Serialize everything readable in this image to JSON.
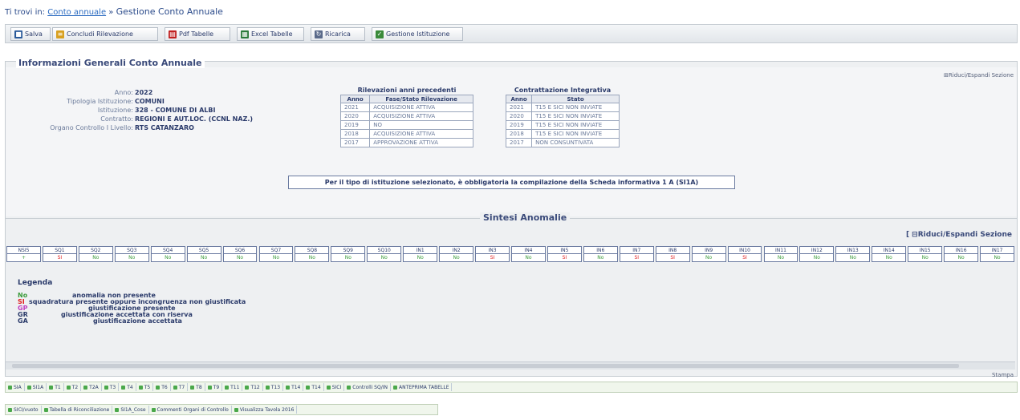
{
  "breadcrumb": {
    "prefix": "Ti trovi in:",
    "link": "Conto annuale",
    "sep": "»",
    "current": "Gestione Conto Annuale"
  },
  "toolbar": [
    {
      "label": "Salva",
      "icon": "save-icon",
      "color": "#2a5a9a"
    },
    {
      "label": "Concludi Rilevazione",
      "icon": "conclude-icon",
      "color": "#d8a020"
    },
    {
      "label": "Pdf Tabelle",
      "icon": "pdf-icon",
      "color": "#c02020"
    },
    {
      "label": "Excel Tabelle",
      "icon": "excel-icon",
      "color": "#2a7a3a"
    },
    {
      "label": "Ricarica",
      "icon": "reload-icon",
      "color": "#5a6a8a"
    },
    {
      "label": "Gestione Istituzione",
      "icon": "check-icon",
      "color": "#3a8a3a"
    }
  ],
  "section_title": "Informazioni Generali Conto Annuale",
  "expand_top": "Riduci/Espandi Sezione",
  "info": {
    "rows": [
      {
        "label": "Anno:",
        "value": "2022"
      },
      {
        "label": "Tipologia Istituzione:",
        "value": "COMUNI"
      },
      {
        "label": "Istituzione:",
        "value": "328 - COMUNE DI ALBI"
      },
      {
        "label": "Contratto:",
        "value": "REGIONI E AUT.LOC. (CCNL NAZ.)"
      },
      {
        "label": "Organo Controllo I Livello:",
        "value": "RTS CATANZARO"
      }
    ]
  },
  "rilevazioni": {
    "caption": "Rilevazioni anni precedenti",
    "headers": [
      "Anno",
      "Fase/Stato Rilevazione"
    ],
    "rows": [
      [
        "2021",
        "ACQUISIZIONE ATTIVA"
      ],
      [
        "2020",
        "ACQUISIZIONE ATTIVA"
      ],
      [
        "2019",
        "NO"
      ],
      [
        "2018",
        "ACQUISIZIONE ATTIVA"
      ],
      [
        "2017",
        "APPROVAZIONE ATTIVA"
      ]
    ]
  },
  "contrattazione": {
    "caption": "Contrattazione Integrativa",
    "headers": [
      "Anno",
      "Stato"
    ],
    "rows": [
      [
        "2021",
        "T15 E SICI NON INVIATE"
      ],
      [
        "2020",
        "T15 E SICI NON INVIATE"
      ],
      [
        "2019",
        "T15 E SICI NON INVIATE"
      ],
      [
        "2018",
        "T15 E SICI NON INVIATE"
      ],
      [
        "2017",
        "NON CONSUNTIVATA"
      ]
    ]
  },
  "notice": "Per il tipo di istituzione selezionato, è obbligatoria la compilazione della Scheda informativa 1 A (SI1A)",
  "sintesi": {
    "title": "Sintesi Anomalie",
    "expand": "Riduci/Espandi Sezione",
    "columns": [
      {
        "h": "NSI5",
        "v": "+"
      },
      {
        "h": "SQ1",
        "v": "SI"
      },
      {
        "h": "SQ2",
        "v": "No"
      },
      {
        "h": "SQ3",
        "v": "No"
      },
      {
        "h": "SQ4",
        "v": "No"
      },
      {
        "h": "SQ5",
        "v": "No"
      },
      {
        "h": "SQ6",
        "v": "No"
      },
      {
        "h": "SQ7",
        "v": "No"
      },
      {
        "h": "SQ8",
        "v": "No"
      },
      {
        "h": "SQ9",
        "v": "No"
      },
      {
        "h": "SQ10",
        "v": "No"
      },
      {
        "h": "IN1",
        "v": "No"
      },
      {
        "h": "IN2",
        "v": "No"
      },
      {
        "h": "IN3",
        "v": "SI"
      },
      {
        "h": "IN4",
        "v": "No"
      },
      {
        "h": "IN5",
        "v": "SI"
      },
      {
        "h": "IN6",
        "v": "No"
      },
      {
        "h": "IN7",
        "v": "SI"
      },
      {
        "h": "IN8",
        "v": "SI"
      },
      {
        "h": "IN9",
        "v": "No"
      },
      {
        "h": "IN10",
        "v": "SI"
      },
      {
        "h": "IN11",
        "v": "No"
      },
      {
        "h": "IN12",
        "v": "No"
      },
      {
        "h": "IN13",
        "v": "No"
      },
      {
        "h": "IN14",
        "v": "No"
      },
      {
        "h": "IN15",
        "v": "No"
      },
      {
        "h": "IN16",
        "v": "No"
      },
      {
        "h": "IN17",
        "v": "No"
      }
    ]
  },
  "legenda": {
    "title": "Legenda",
    "items": [
      {
        "code": "No",
        "desc": "anomalia non presente",
        "color": "#3a9a3a"
      },
      {
        "code": "SI",
        "desc": "squadratura presente oppure incongruenza non giustificata",
        "color": "#e02020"
      },
      {
        "code": "GP",
        "desc": "giustificazione presente",
        "color": "#c040c0"
      },
      {
        "code": "GR",
        "desc": "giustificazione accettata con riserva",
        "color": "#2a3a6a"
      },
      {
        "code": "GA",
        "desc": "giustificazione accettata",
        "color": "#2a3a6a"
      }
    ]
  },
  "bottom_right": "Stampa",
  "tabs_row1": [
    "SIA",
    "SI1A",
    "T1",
    "T2",
    "T2A",
    "T3",
    "T4",
    "T5",
    "T6",
    "T7",
    "T8",
    "T9",
    "T11",
    "T12",
    "T13",
    "T14",
    "T14",
    "SICI",
    "Controlli SQ/IN",
    "ANTEPRIMA TABELLE"
  ],
  "tabs_row2": [
    "SICI/vuoto",
    "Tabella di Riconciliazione",
    "SI1A_Cose",
    "Commenti Organi di Controllo",
    "Visualizza Tavola 2016"
  ]
}
